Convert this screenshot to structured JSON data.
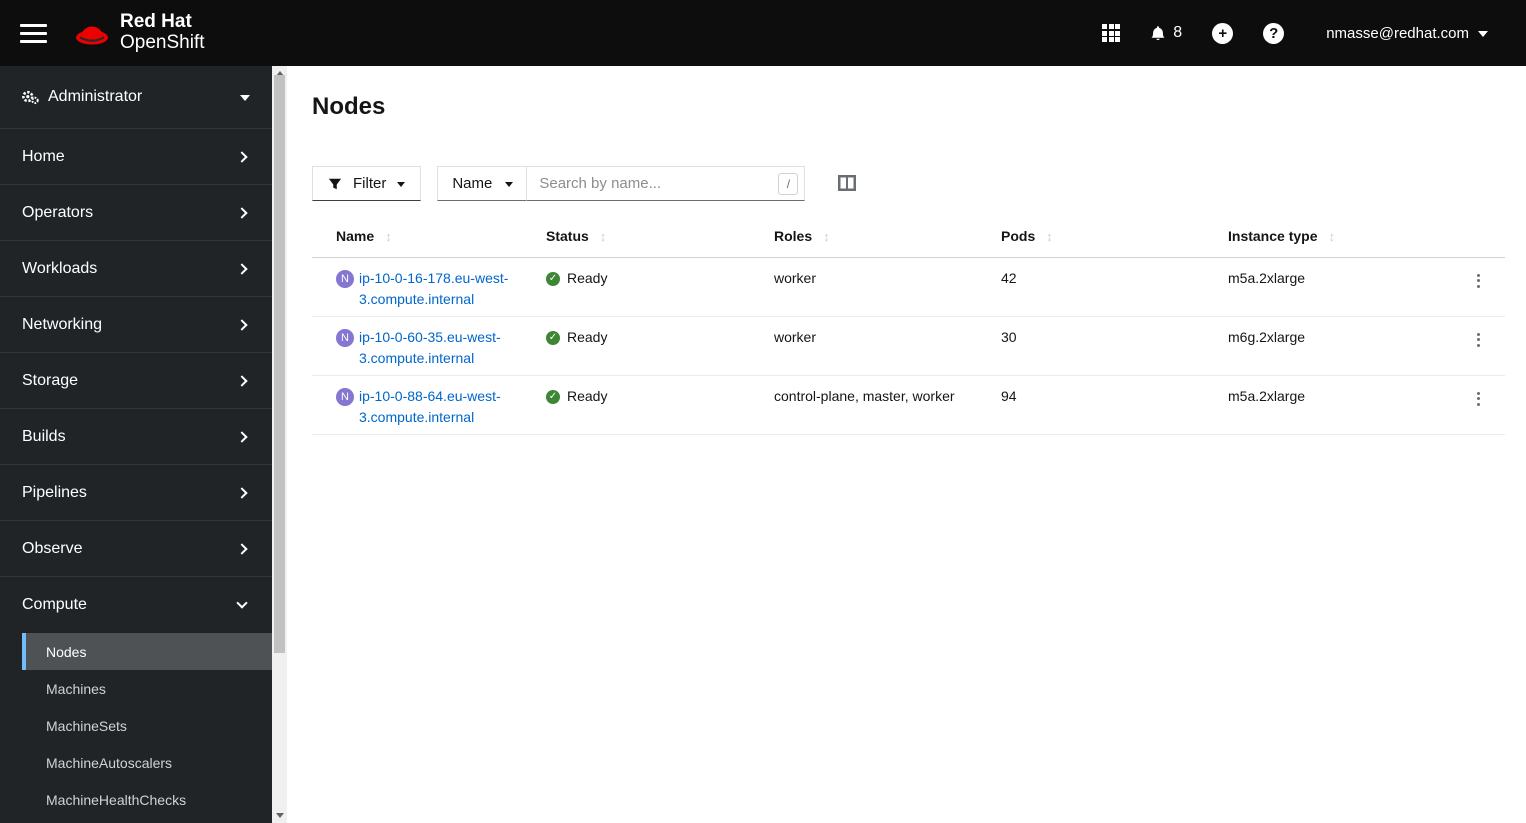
{
  "header": {
    "brand": {
      "line1": "Red Hat",
      "line2": "OpenShift"
    },
    "notification_count": "8",
    "username": "nmasse@redhat.com",
    "icons": {
      "nav_toggle": "hamburger",
      "apps_launcher": "3x3-grid",
      "notifications": "bell",
      "add": "plus-circle",
      "help": "question-circle",
      "user_caret": "caret-down"
    }
  },
  "sidebar": {
    "perspective_label": "Administrator",
    "perspective_icon": "cogs",
    "items": [
      {
        "label": "Home"
      },
      {
        "label": "Operators"
      },
      {
        "label": "Workloads"
      },
      {
        "label": "Networking"
      },
      {
        "label": "Storage"
      },
      {
        "label": "Builds"
      },
      {
        "label": "Pipelines"
      },
      {
        "label": "Observe"
      },
      {
        "label": "Compute",
        "expanded": true
      }
    ],
    "compute_subitems": [
      {
        "label": "Nodes",
        "selected": true
      },
      {
        "label": "Machines"
      },
      {
        "label": "MachineSets"
      },
      {
        "label": "MachineAutoscalers"
      },
      {
        "label": "MachineHealthChecks"
      }
    ]
  },
  "main": {
    "title": "Nodes",
    "toolbar": {
      "filter_label": "Filter",
      "filter_icon": "funnel",
      "name_filter_label": "Name",
      "search_placeholder": "Search by name...",
      "shortcut_hint": "/",
      "column_management_icon": "columns"
    },
    "table": {
      "columns": [
        "Name",
        "Status",
        "Roles",
        "Pods",
        "Instance type"
      ],
      "sort_icon": "up-down-arrows",
      "badge_letter": "N",
      "status_ok_icon": "check-circle",
      "row_actions_icon": "kebab-vertical-dots",
      "rows": [
        {
          "name": "ip-10-0-16-178.eu-west-3.compute.internal",
          "status": "Ready",
          "roles": "worker",
          "pods": "42",
          "instance_type": "m5a.2xlarge"
        },
        {
          "name": "ip-10-0-60-35.eu-west-3.compute.internal",
          "status": "Ready",
          "roles": "worker",
          "pods": "30",
          "instance_type": "m6g.2xlarge"
        },
        {
          "name": "ip-10-0-88-64.eu-west-3.compute.internal",
          "status": "Ready",
          "roles": "control-plane, master, worker",
          "pods": "94",
          "instance_type": "m5a.2xlarge"
        }
      ]
    }
  },
  "colors": {
    "masthead_bg": "#0d0d0d",
    "sidebar_bg": "#212427",
    "sidebar_selected_bg": "#4f5255",
    "selected_indicator_blue": "#73bcf7",
    "brand_red": "#ee0000",
    "link_blue": "#0066cc",
    "success_green": "#3e8635",
    "node_badge_purple": "#8476d1"
  }
}
